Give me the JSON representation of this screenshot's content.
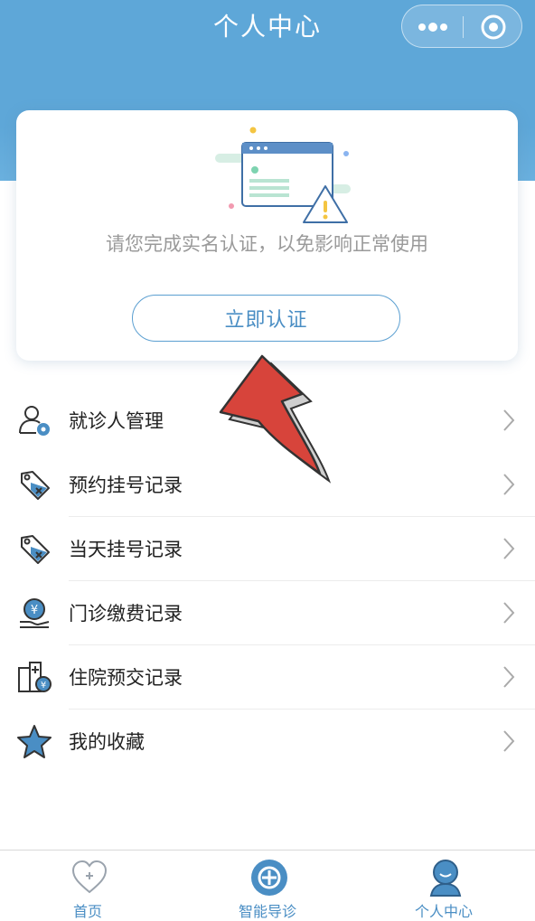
{
  "header": {
    "title": "个人中心"
  },
  "card": {
    "hint": "请您完成实名认证，以免影响正常使用",
    "button_label": "立即认证"
  },
  "menu": [
    {
      "label": "就诊人管理",
      "icon": "patient-manage-icon"
    },
    {
      "label": "预约挂号记录",
      "icon": "appointment-tag-icon"
    },
    {
      "label": "当天挂号记录",
      "icon": "same-day-tag-icon"
    },
    {
      "label": "门诊缴费记录",
      "icon": "payment-icon"
    },
    {
      "label": "住院预交记录",
      "icon": "hospital-icon"
    },
    {
      "label": "我的收藏",
      "icon": "star-icon"
    }
  ],
  "tabbar": [
    {
      "label": "首页",
      "icon": "home-heart-icon"
    },
    {
      "label": "智能导诊",
      "icon": "guide-icon"
    },
    {
      "label": "个人中心",
      "icon": "profile-icon",
      "active": true
    }
  ],
  "colors": {
    "accent": "#5ea7d8",
    "link": "#4a8ec4",
    "arrow": "#d7443b"
  }
}
